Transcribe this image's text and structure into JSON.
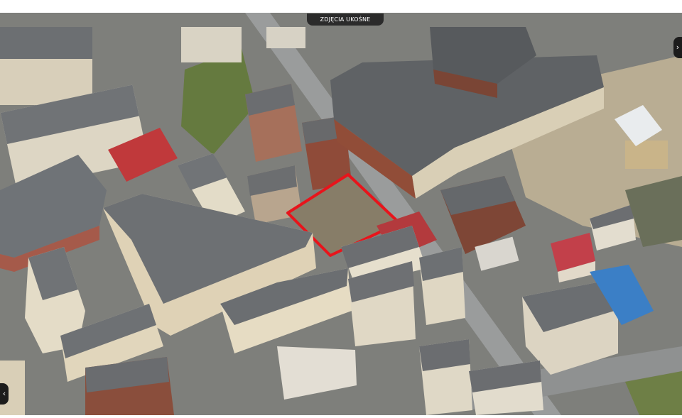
{
  "map": {
    "view_mode_label": "ZDJĘCIA UKOŚNE",
    "pan_right_symbol": "›",
    "pan_left_symbol": "‹"
  },
  "colors": {
    "plot_outline": "#e8141b",
    "roof_gray": "#6f7275",
    "facade_cream": "#e7dcc1",
    "brick": "#8d4a37",
    "sports_field": "#c0393b",
    "blue_roof": "#3b7fc6",
    "tent_white": "#e9ecee"
  },
  "icons": [
    "chevron-right-icon",
    "chevron-left-icon"
  ]
}
